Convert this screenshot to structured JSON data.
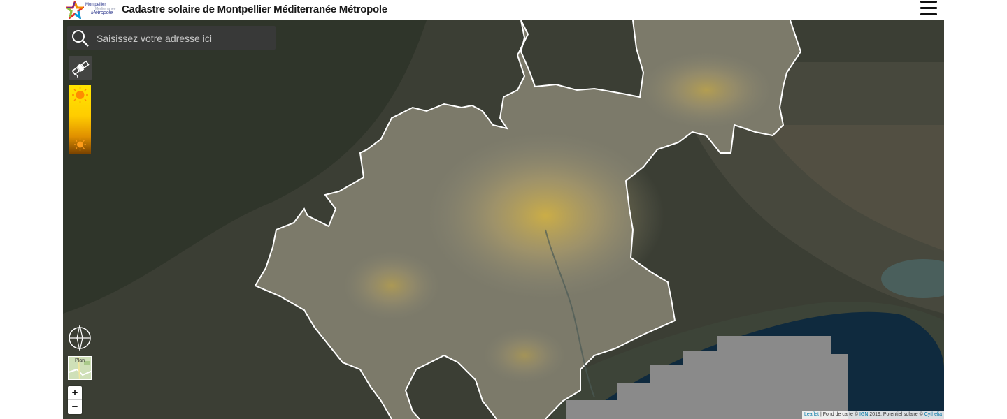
{
  "header": {
    "title": "Cadastre solaire de Montpellier Méditerranée Métropole",
    "logo": {
      "line1": "Montpellier",
      "line2": "Méditerranée",
      "line3": "Métropole",
      "colors": [
        "#e4312b",
        "#f39200",
        "#009fe3",
        "#8cc63f",
        "#6a2c91"
      ]
    },
    "menu_icon": "hamburger-menu-icon"
  },
  "search": {
    "placeholder": "Saisissez votre adresse ici",
    "value": "",
    "icon": "search-icon"
  },
  "controls": {
    "satellite_icon": "satellite-icon",
    "legend": {
      "high_icon": "sun-icon",
      "low_icon": "sun-icon",
      "gradient_colors": [
        "#ffe600",
        "#ffcc00",
        "#e09000",
        "#7a4200"
      ]
    },
    "compass_icon": "compass-icon",
    "basemap_toggle_label": "Plan",
    "zoom_in": "+",
    "zoom_out": "−"
  },
  "attribution": {
    "leaflet": "Leaflet",
    "sep": " | ",
    "fond": "Fond de carte © ",
    "ign": "IGN",
    "year": " 2019, Potentiel solaire © ",
    "cythelia": "Cythelia"
  },
  "map": {
    "boundary_color": "#ffffff",
    "solar_highlight_color": "#f5c518",
    "sea_color": "#0f2a3e",
    "nodata_color": "#8a8a8a"
  }
}
